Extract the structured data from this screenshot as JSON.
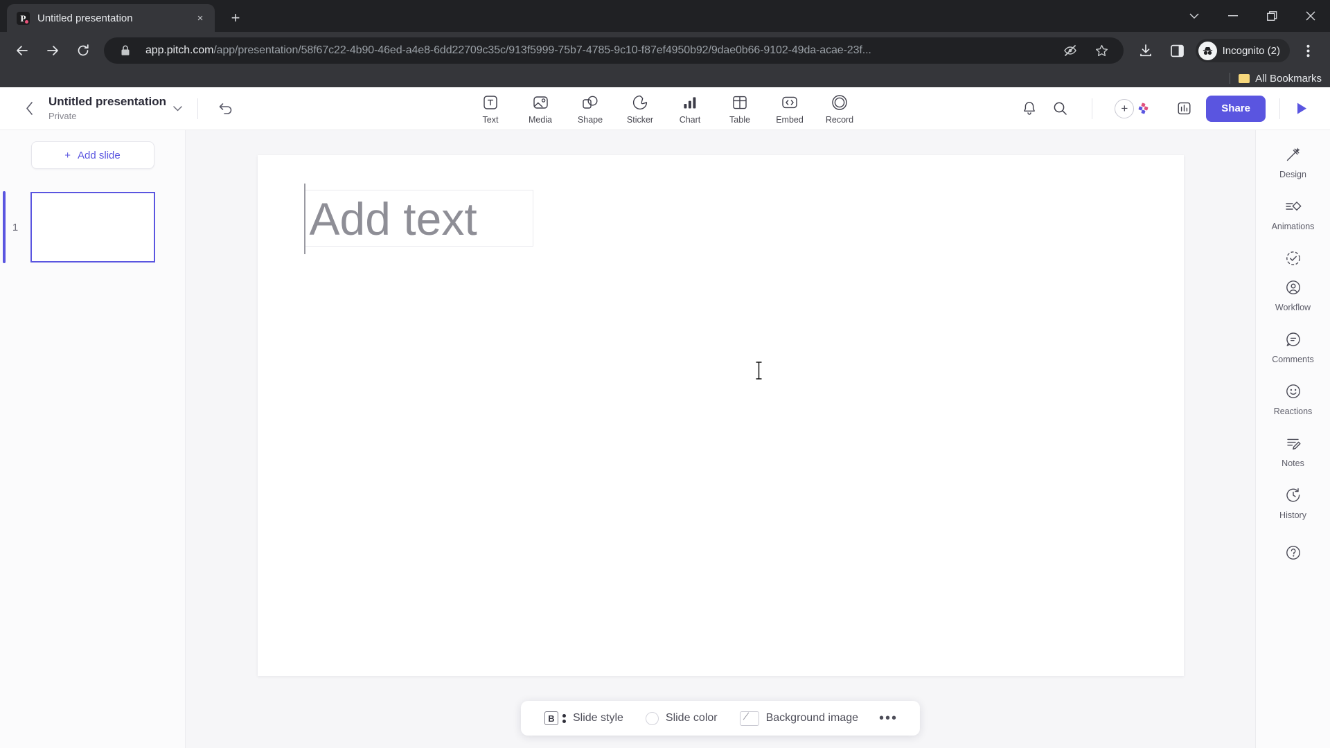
{
  "browser": {
    "tab": {
      "title": "Untitled presentation",
      "favicon_letter": "P",
      "close_label": "×"
    },
    "new_tab_label": "+",
    "window_controls": {
      "list_label": "⌄",
      "minimize_label": "—",
      "maximize_label": "❐",
      "close_label": "✕"
    },
    "nav": {
      "back_label": "←",
      "forward_label": "→",
      "reload_label": "↻"
    },
    "url": {
      "domain": "app.pitch.com",
      "path": "/app/presentation/58f67c22-4b90-46ed-a4e8-6dd22709c35c/913f5999-75b7-4785-9c10-f87ef4950b92/9dae0b66-9102-49da-acae-23f...",
      "lock_icon": "lock-icon",
      "tracking_blocked_icon": "eye-slash-icon",
      "bookmark_icon": "star-icon"
    },
    "toolbar_right": {
      "download_icon": "download-icon",
      "side_panel_icon": "side-panel-icon",
      "profile_label": "Incognito (2)",
      "menu_icon": "three-dot-menu-icon"
    },
    "bookmarks_bar": {
      "all_bookmarks_label": "All Bookmarks"
    }
  },
  "app": {
    "header": {
      "back_label": "‹",
      "title": "Untitled presentation",
      "visibility": "Private",
      "dropdown_icon": "chevron-down-icon",
      "undo_icon": "undo-icon",
      "tools": [
        {
          "label": "Text",
          "icon": "text-icon"
        },
        {
          "label": "Media",
          "icon": "media-icon"
        },
        {
          "label": "Shape",
          "icon": "shape-icon"
        },
        {
          "label": "Sticker",
          "icon": "sticker-icon"
        },
        {
          "label": "Chart",
          "icon": "chart-icon"
        },
        {
          "label": "Table",
          "icon": "table-icon"
        },
        {
          "label": "Embed",
          "icon": "embed-icon"
        },
        {
          "label": "Record",
          "icon": "record-icon"
        }
      ],
      "notifications_icon": "bell-icon",
      "search_icon": "search-icon",
      "add_collaborator_label": "+",
      "analytics_icon": "analytics-icon",
      "share_label": "Share",
      "present_icon": "play-icon"
    },
    "slides_panel": {
      "add_slide_label": "Add slide",
      "add_slide_plus": "+",
      "slides": [
        {
          "number": "1"
        }
      ]
    },
    "canvas": {
      "text_placeholder": "Add text"
    },
    "bottom_bar": {
      "slide_style_label": "Slide style",
      "slide_style_icon": "bold-b-icon",
      "slide_color_label": "Slide color",
      "slide_color_icon": "color-circle-icon",
      "background_image_label": "Background image",
      "background_image_icon": "image-slash-icon",
      "more_label": "•••"
    },
    "right_sidebar": [
      {
        "label": "Design",
        "icon": "design-wand-icon"
      },
      {
        "label": "Animations",
        "icon": "animations-icon"
      },
      {
        "label": "Workflow",
        "icon": "workflow-check-icon"
      },
      {
        "label": "Comments",
        "icon": "comment-icon"
      },
      {
        "label": "Reactions",
        "icon": "smiley-icon"
      },
      {
        "label": "Notes",
        "icon": "notes-pencil-icon"
      },
      {
        "label": "History",
        "icon": "history-clock-icon"
      }
    ],
    "right_sidebar_help": {
      "icon": "help-question-icon"
    }
  },
  "colors": {
    "accent": "#5a55e0",
    "chrome_dark": "#35363a",
    "chrome_darker": "#202124",
    "canvas_bg": "#f6f6f8"
  }
}
